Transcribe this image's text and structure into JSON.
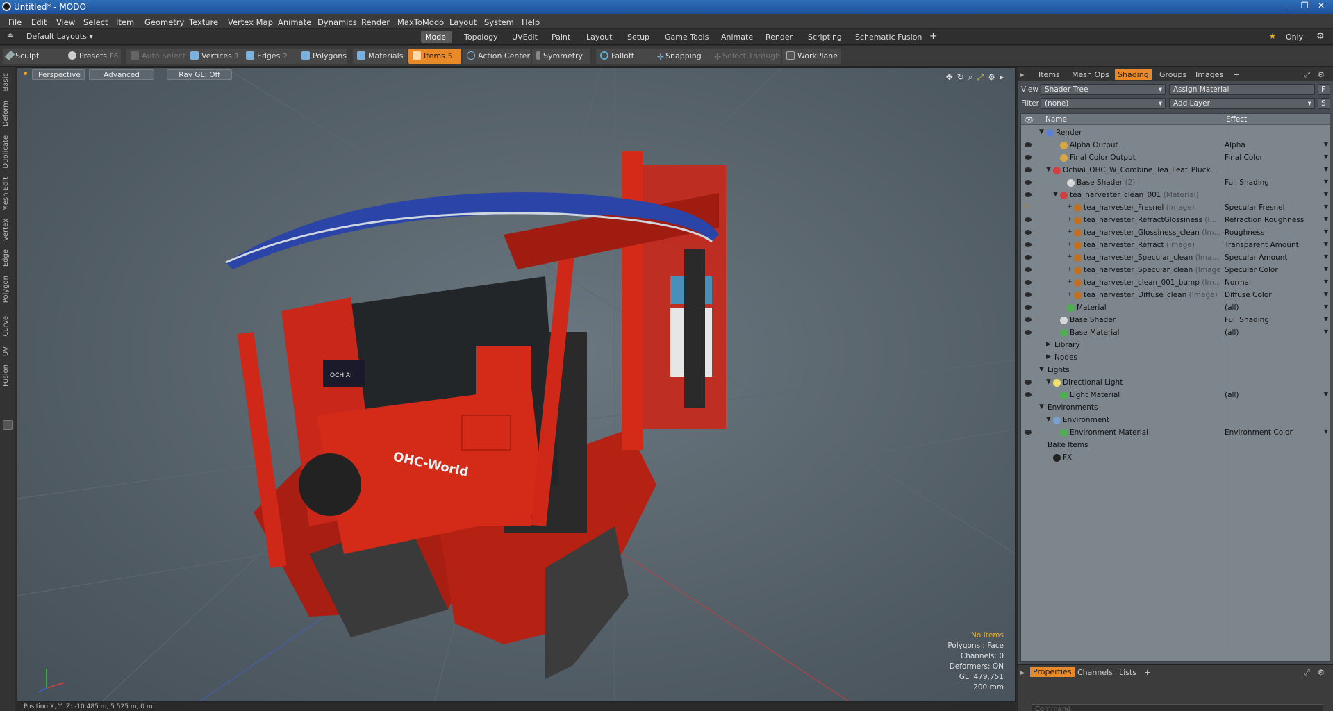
{
  "window": {
    "title": "Untitled* - MODO",
    "controls": [
      "—",
      "❐",
      "✕"
    ]
  },
  "menu": {
    "items": [
      "File",
      "Edit",
      "View",
      "Select",
      "Item",
      "Geometry",
      "Texture",
      "Vertex Map",
      "Animate",
      "Dynamics",
      "Render",
      "MaxToModo",
      "Layout",
      "System",
      "Help"
    ]
  },
  "layouts": {
    "selector": "Default Layouts",
    "tabs": [
      "Model",
      "Topology",
      "UVEdit",
      "Paint",
      "Layout",
      "Setup",
      "Game Tools",
      "Animate",
      "Render",
      "Scripting",
      "Schematic Fusion"
    ],
    "active_tab": "Model",
    "add": "+",
    "only_label": "Only"
  },
  "toolbar": {
    "sculpt": "Sculpt",
    "presets": "Presets",
    "presets_key": "F6",
    "auto_select": "Auto Select",
    "vertices": "Vertices",
    "vertices_key": "1",
    "edges": "Edges",
    "edges_key": "2",
    "polygons": "Polygons",
    "materials": "Materials",
    "items": "Items",
    "items_key": "5",
    "action_center": "Action Center",
    "symmetry": "Symmetry",
    "falloff": "Falloff",
    "snapping": "Snapping",
    "select_through": "Select Through",
    "workplane": "WorkPlane"
  },
  "left_tabs": [
    "Basic",
    "Deform",
    "Duplicate",
    "Mesh Edit",
    "Vertex",
    "Edge",
    "Polygon",
    "Curve",
    "UV",
    "Fusion"
  ],
  "viewport": {
    "view": "Perspective",
    "shading": "Advanced",
    "raygl": "Ray GL: Off",
    "hud": {
      "no_items": "No Items",
      "polygons": "Polygons : Face",
      "channels": "Channels: 0",
      "deformers": "Deformers: ON",
      "gl": "GL: 479,751",
      "scale": "200 mm"
    },
    "model_labels": {
      "brand": "OCHIAI",
      "side_text": "OHC-World"
    },
    "status": "Position X, Y, Z:  -10.485 m, 5.525 m, 0 m"
  },
  "right_panel": {
    "tabs": [
      "Items",
      "Mesh Ops",
      "Shading",
      "Groups",
      "Images"
    ],
    "active_tab": "Shading",
    "add": "+",
    "view_label": "View",
    "view_value": "Shader Tree",
    "assign_material": "Assign Material",
    "filter_label": "Filter",
    "filter_value": "(none)",
    "add_layer": "Add Layer",
    "f_btn": "F",
    "s_btn": "S",
    "columns": {
      "name": "Name",
      "effect": "Effect"
    },
    "rows": [
      {
        "name": "Render",
        "sub": "",
        "effect": "",
        "indent": 0,
        "expand": "▼",
        "eye": false,
        "color": "#5b7fd6",
        "dd": false
      },
      {
        "name": "Alpha Output",
        "sub": "",
        "effect": "Alpha",
        "indent": 2,
        "expand": "",
        "eye": true,
        "color": "#d9a640",
        "dd": true
      },
      {
        "name": "Final Color Output",
        "sub": "",
        "effect": "Final Color",
        "indent": 2,
        "expand": "",
        "eye": true,
        "color": "#d9a640",
        "dd": true
      },
      {
        "name": "Ochiai_OHC_W_Combine_Tea_Leaf_Pluck...",
        "sub": "",
        "effect": "",
        "indent": 1,
        "expand": "▼",
        "eye": true,
        "color": "#d04040",
        "dd": true
      },
      {
        "name": "Base Shader",
        "sub": " (2)",
        "effect": "Full Shading",
        "indent": 3,
        "expand": "",
        "eye": true,
        "color": "#d8d8d8",
        "dd": true
      },
      {
        "name": "tea_harvester_clean_001",
        "sub": " (Material)",
        "effect": "",
        "indent": 2,
        "expand": "▼",
        "eye": true,
        "color": "#d04040",
        "dd": true
      },
      {
        "name": "tea_harvester_Fresnel",
        "sub": " (Image)",
        "effect": "Specular Fresnel",
        "indent": 4,
        "expand": "+",
        "eye": false,
        "brush": true,
        "color": "#c07020",
        "dd": true
      },
      {
        "name": "tea_harvester_RefractGlossiness",
        "sub": " (I...",
        "effect": "Refraction Roughness",
        "indent": 4,
        "expand": "+",
        "eye": true,
        "color": "#c07020",
        "dd": true
      },
      {
        "name": "tea_harvester_Glossiness_clean",
        "sub": " (Im...",
        "effect": "Roughness",
        "indent": 4,
        "expand": "+",
        "eye": true,
        "color": "#c07020",
        "dd": true
      },
      {
        "name": "tea_harvester_Refract",
        "sub": " (Image)",
        "effect": "Transparent Amount",
        "indent": 4,
        "expand": "+",
        "eye": true,
        "color": "#c07020",
        "dd": true
      },
      {
        "name": "tea_harvester_Specular_clean",
        "sub": " (Ima...",
        "effect": "Specular Amount",
        "indent": 4,
        "expand": "+",
        "eye": true,
        "color": "#c07020",
        "dd": true
      },
      {
        "name": "tea_harvester_Specular_clean",
        "sub": " (Image)",
        "effect": "Specular Color",
        "indent": 4,
        "expand": "+",
        "eye": true,
        "color": "#c07020",
        "dd": true
      },
      {
        "name": "tea_harvester_clean_001_bump",
        "sub": " (Im...",
        "effect": "Normal",
        "indent": 4,
        "expand": "+",
        "eye": true,
        "color": "#c07020",
        "dd": true
      },
      {
        "name": "tea_harvester_Diffuse_clean",
        "sub": " (Image)",
        "effect": "Diffuse Color",
        "indent": 4,
        "expand": "+",
        "eye": true,
        "color": "#c07020",
        "dd": true
      },
      {
        "name": "Material",
        "sub": "",
        "effect": "(all)",
        "indent": 3,
        "expand": "",
        "eye": true,
        "color": "#4caf50",
        "dd": true
      },
      {
        "name": "Base Shader",
        "sub": "",
        "effect": "Full Shading",
        "indent": 2,
        "expand": "",
        "eye": true,
        "color": "#d8d8d8",
        "dd": true
      },
      {
        "name": "Base Material",
        "sub": "",
        "effect": "(all)",
        "indent": 2,
        "expand": "",
        "eye": true,
        "color": "#4caf50",
        "dd": true
      },
      {
        "name": "Library",
        "sub": "",
        "effect": "",
        "indent": 1,
        "expand": "▶",
        "eye": false,
        "color": "",
        "dd": false
      },
      {
        "name": "Nodes",
        "sub": "",
        "effect": "",
        "indent": 1,
        "expand": "▶",
        "eye": false,
        "color": "",
        "dd": false
      },
      {
        "name": "Lights",
        "sub": "",
        "effect": "",
        "indent": 0,
        "expand": "▼",
        "eye": false,
        "color": "",
        "dd": false
      },
      {
        "name": "Directional Light",
        "sub": "",
        "effect": "",
        "indent": 1,
        "expand": "▼",
        "eye": true,
        "color": "#f0e070",
        "dd": false
      },
      {
        "name": "Light Material",
        "sub": "",
        "effect": "(all)",
        "indent": 2,
        "expand": "",
        "eye": true,
        "color": "#4caf50",
        "dd": true
      },
      {
        "name": "Environments",
        "sub": "",
        "effect": "",
        "indent": 0,
        "expand": "▼",
        "eye": false,
        "color": "",
        "dd": false
      },
      {
        "name": "Environment",
        "sub": "",
        "effect": "",
        "indent": 1,
        "expand": "▼",
        "eye": false,
        "color": "#7aa0d0",
        "dd": false
      },
      {
        "name": "Environment Material",
        "sub": "",
        "effect": "Environment Color",
        "indent": 2,
        "expand": "",
        "eye": true,
        "color": "#4caf50",
        "dd": true
      },
      {
        "name": "Bake Items",
        "sub": "",
        "effect": "",
        "indent": 0,
        "expand": "",
        "eye": false,
        "color": "",
        "dd": false
      },
      {
        "name": "FX",
        "sub": "",
        "effect": "",
        "indent": 1,
        "expand": "",
        "eye": false,
        "color": "#222222",
        "dd": false
      }
    ]
  },
  "bottom_panel": {
    "tabs": [
      "Properties",
      "Channels",
      "Lists"
    ],
    "active_tab": "Properties",
    "add": "+",
    "command_placeholder": "Command"
  },
  "colors": {
    "accent": "#e8892a",
    "harvester_red": "#d42a18",
    "canopy_blue": "#2a44a8"
  }
}
